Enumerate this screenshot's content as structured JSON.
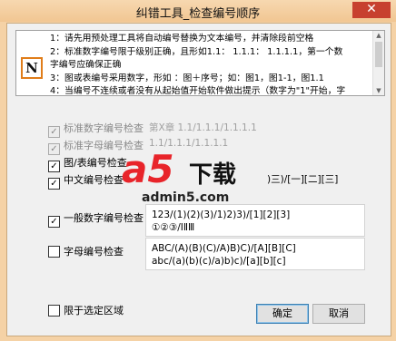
{
  "window": {
    "title": "纠错工具_检查编号顺序",
    "close_glyph": "✕"
  },
  "info": {
    "logo_letter": "N",
    "lines": [
      "1：请先用预处理工具将自动编号替换为文本编号，并清除段前空格",
      "2：标准数字编号限于级别正确，且形如1.1：  1.1.1：  1.1.1.1，第一个数",
      "字编号应确保正确",
      "3：图或表编号采用数字，形如 ：图＋序号；如：图1，图1-1，图1.1",
      "4：当编号不连续或者没有从起始值开始软件做出提示（数字为\"1\"开始，字"
    ]
  },
  "options": {
    "std_number": {
      "label": "标准数字编号检查",
      "checked": true,
      "enabled": false,
      "example": "第X章 1.1/1.1.1/1.1.1.1"
    },
    "std_letter": {
      "label": "标准字母编号检查",
      "checked": true,
      "enabled": false,
      "example": "1.1/1.1.1/1.1.1.1"
    },
    "figure_table": {
      "label": "图/表编号检查",
      "checked": true,
      "enabled": true
    },
    "chinese": {
      "label": "中文编号检查",
      "checked": true,
      "enabled": true,
      "example": ")三)/[一][二][三]"
    },
    "general_number": {
      "label": "一般数字编号检查",
      "checked": true,
      "enabled": true,
      "example_lines": [
        "123/(1)(2)(3)/1)2)3)/[1][2][3]",
        "①②③/ⅠⅡⅢ"
      ]
    },
    "letter": {
      "label": "字母编号检查",
      "checked": false,
      "enabled": true,
      "example_lines": [
        "ABC/(A)(B)(C)/A)B)C)/[A][B][C]",
        "abc/(a)(b)(c)/a)b)c)/[a][b][c]"
      ]
    },
    "selected_region": {
      "label": "限于选定区域",
      "checked": false,
      "enabled": true
    }
  },
  "buttons": {
    "ok": "确定",
    "cancel": "取消"
  },
  "watermark": {
    "brand": "a5",
    "download": "下载",
    "url": "admin5.com"
  },
  "check_glyph": "✓"
}
